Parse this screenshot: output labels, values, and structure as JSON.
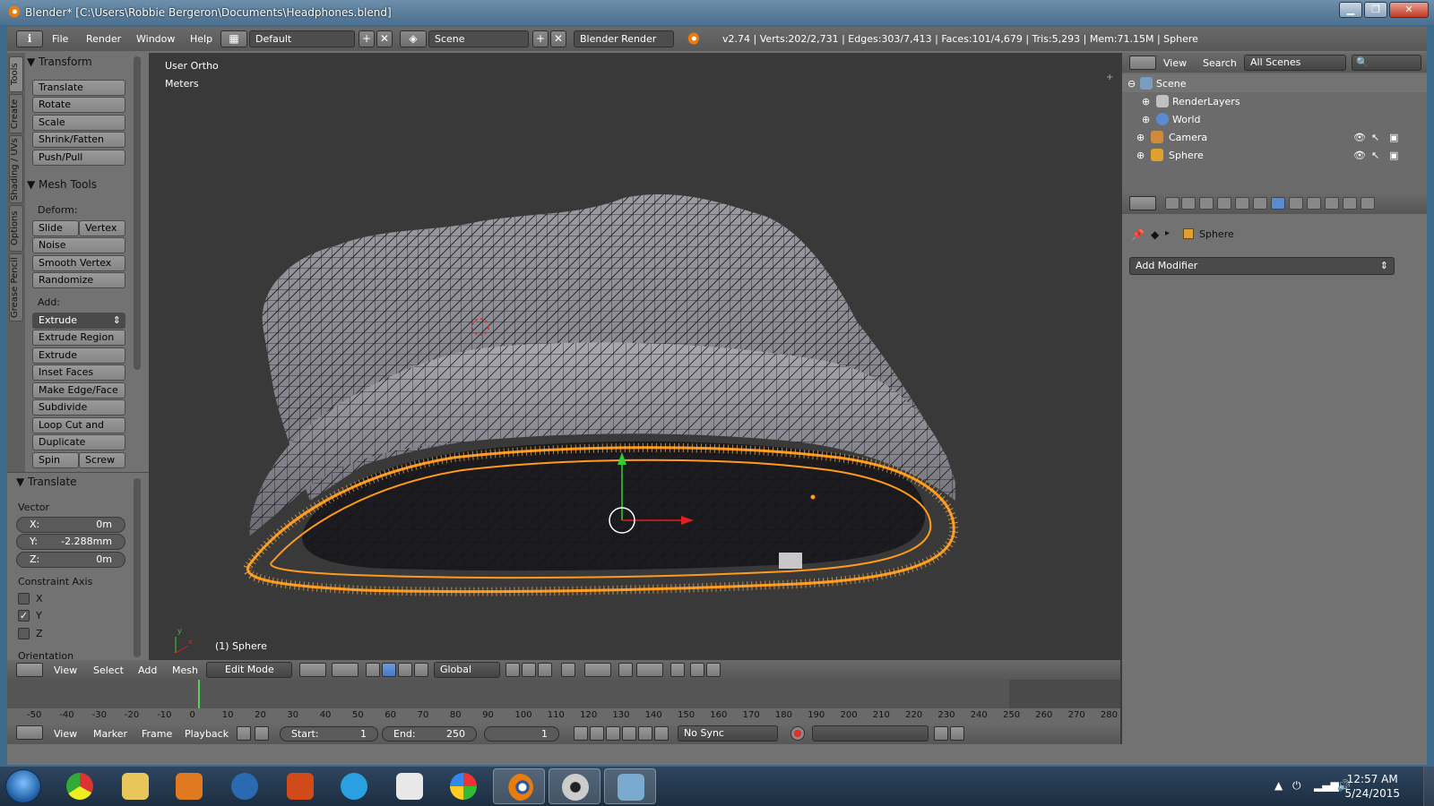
{
  "window": {
    "title": "Blender* [C:\\Users\\Robbie Bergeron\\Documents\\Headphones.blend]",
    "min": "▁",
    "max": "❐",
    "close": "✕"
  },
  "topbar": {
    "menus": [
      "File",
      "Render",
      "Window",
      "Help"
    ],
    "layout": "Default",
    "scene": "Scene",
    "engine": "Blender Render",
    "stats": "v2.74 | Verts:202/2,731 | Edges:303/7,413 | Faces:101/4,679 | Tris:5,293 | Mem:71.15M | Sphere"
  },
  "toolshelf": {
    "tabs": [
      "Tools",
      "Create",
      "Shading / UVs",
      "Options",
      "Grease Pencil"
    ],
    "transform": {
      "title": "Transform",
      "buttons": [
        "Translate",
        "Rotate",
        "Scale",
        "Shrink/Fatten",
        "Push/Pull"
      ]
    },
    "mesh_tools": {
      "title": "Mesh Tools",
      "deform_label": "Deform:",
      "slide_edge": "Slide Ed",
      "vertex": "Vertex",
      "deform_buttons": [
        "Noise",
        "Smooth Vertex",
        "Randomize"
      ],
      "add_label": "Add:",
      "extrude": "Extrude",
      "add_buttons": [
        "Extrude Region",
        "Extrude Individual",
        "Inset Faces",
        "Make Edge/Face",
        "Subdivide",
        "Loop Cut and Slide",
        "Duplicate"
      ],
      "spin": "Spin",
      "screw": "Screw"
    },
    "operator": {
      "title": "Translate",
      "vector_label": "Vector",
      "x": {
        "k": "X:",
        "v": "0m"
      },
      "y": {
        "k": "Y:",
        "v": "-2.288mm"
      },
      "z": {
        "k": "Z:",
        "v": "0m"
      },
      "constraint_label": "Constraint Axis",
      "axes": [
        {
          "label": "X",
          "checked": false
        },
        {
          "label": "Y",
          "checked": true
        },
        {
          "label": "Z",
          "checked": false
        }
      ],
      "orientation_label": "Orientation"
    }
  },
  "viewport": {
    "view_name": "User Ortho",
    "units": "Meters",
    "object_label": "(1) Sphere",
    "axis_x": "x",
    "axis_y": "y"
  },
  "view_header": {
    "menus": [
      "View",
      "Select",
      "Add",
      "Mesh"
    ],
    "mode": "Edit Mode",
    "orientation": "Global"
  },
  "timeline": {
    "ticks": [
      "-50",
      "-40",
      "-30",
      "-20",
      "-10",
      "0",
      "10",
      "20",
      "30",
      "40",
      "50",
      "60",
      "70",
      "80",
      "90",
      "100",
      "110",
      "120",
      "130",
      "140",
      "150",
      "160",
      "170",
      "180",
      "190",
      "200",
      "210",
      "220",
      "230",
      "240",
      "250",
      "260",
      "270",
      "280"
    ],
    "menus": [
      "View",
      "Marker",
      "Frame",
      "Playback"
    ],
    "start_label": "Start:",
    "start": "1",
    "end_label": "End:",
    "end": "250",
    "current": "1",
    "sync": "No Sync"
  },
  "outliner": {
    "menus": [
      "View",
      "Search"
    ],
    "filter": "All Scenes",
    "items": [
      {
        "name": "Scene",
        "color": "#7a9ec0"
      },
      {
        "name": "RenderLayers",
        "color": "#c0c0c0"
      },
      {
        "name": "World",
        "color": "#5a8ad0"
      },
      {
        "name": "Camera",
        "color": "#d08a3a"
      },
      {
        "name": "Sphere",
        "color": "#e0a030"
      }
    ]
  },
  "properties": {
    "object_name": "Sphere",
    "add_modifier": "Add Modifier"
  },
  "taskbar": {
    "time": "12:57 AM",
    "date": "5/24/2015"
  },
  "colors": {
    "selection": "#ff9a1a",
    "wire": "#111111",
    "viewport_bg": "#393939"
  }
}
